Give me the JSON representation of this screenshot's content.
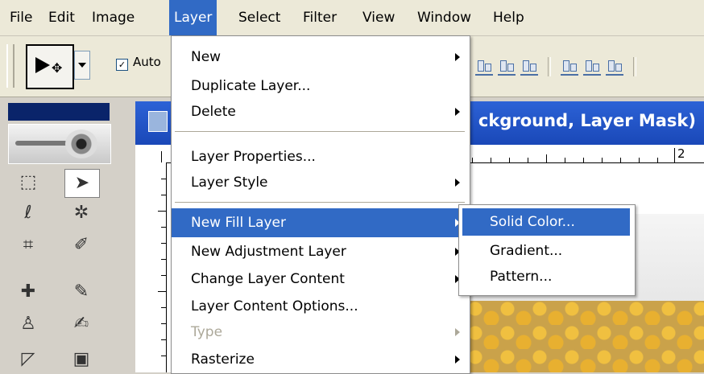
{
  "menubar": {
    "items": [
      {
        "label": "File"
      },
      {
        "label": "Edit"
      },
      {
        "label": "Image"
      },
      {
        "label": "Layer"
      },
      {
        "label": "Select"
      },
      {
        "label": "Filter"
      },
      {
        "label": "View"
      },
      {
        "label": "Window"
      },
      {
        "label": "Help"
      }
    ],
    "active": "Layer"
  },
  "options_bar": {
    "auto_select_label": "Auto",
    "auto_select_checked": true
  },
  "document": {
    "title_fragment": "ckground, Layer Mask)",
    "ruler_label": "2"
  },
  "layer_menu": {
    "items": [
      {
        "label": "New",
        "submenu": true
      },
      {
        "label": "Duplicate Layer..."
      },
      {
        "label": "Delete",
        "submenu": true
      },
      {
        "label": "Layer Properties..."
      },
      {
        "label": "Layer Style",
        "submenu": true
      },
      {
        "label": "New Fill Layer",
        "submenu": true,
        "highlighted": true
      },
      {
        "label": "New Adjustment Layer",
        "submenu": true
      },
      {
        "label": "Change Layer Content",
        "submenu": true
      },
      {
        "label": "Layer Content Options..."
      },
      {
        "label": "Type",
        "submenu": true,
        "disabled": true
      },
      {
        "label": "Rasterize",
        "submenu": true
      }
    ]
  },
  "fill_submenu": {
    "items": [
      {
        "label": "Solid Color...",
        "highlighted": true
      },
      {
        "label": "Gradient..."
      },
      {
        "label": "Pattern..."
      }
    ]
  },
  "colors": {
    "highlight": "#316ac5",
    "menubar_bg": "#ece9d8",
    "title_bar": "#2c62d6"
  }
}
